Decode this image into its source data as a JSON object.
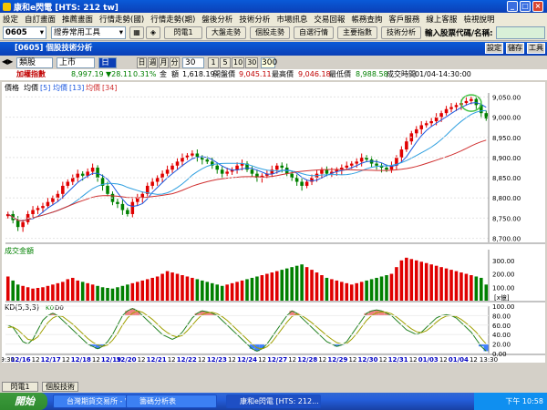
{
  "titlebar": {
    "title": "康和e閃電 [HTS: 212 tw]"
  },
  "menu": [
    "設定",
    "自訂畫面",
    "推薦畫面",
    "行情走勢(國)",
    "行情走勢(期)",
    "盤後分析",
    "技術分析",
    "市場訊息",
    "交易回報",
    "帳務查詢",
    "客戶服務",
    "線上客服",
    "檢視說明"
  ],
  "toolbar1": {
    "code": "0605",
    "group": "證券常用工具",
    "btn1": "閃電1",
    "btn2": "大盤走勢",
    "btn3": "個股走勢",
    "btn4": "自選行情",
    "btn5": "主要指數",
    "btn6": "技術分析",
    "prompt": "輸入股票代碼/名稱:"
  },
  "childbar": {
    "title": "[0605] 個股技術分析",
    "btn_settings": "設定",
    "btn_save": "儲存",
    "btn_tools": "工具"
  },
  "toolbar2": {
    "type": "類股",
    "market": "上市",
    "sel": "日",
    "periods": [
      "日",
      "週",
      "月",
      "分"
    ],
    "interval": "30",
    "nums": [
      "1",
      "5",
      "10",
      "30"
    ],
    "count": "300"
  },
  "infobar": {
    "name": "加權指數",
    "price": "8,997.19",
    "change": "▼28.11",
    "pct": "0.31%",
    "amount_label": "金",
    "amount2_label": "額",
    "amount": "1,618.19",
    "open_label": "開盤價",
    "open": "9,045.11",
    "high_label": "最高價",
    "high": "9,046.18",
    "low_label": "最低價",
    "low": "8,988.58",
    "time_label": "成交時間",
    "time": "01/04-14:30:00"
  },
  "legend": {
    "price": "價格",
    "ma_label": "均價",
    "ma5": "[5]",
    "ma13_label": "均價",
    "ma13": "[13]",
    "ma34_label": "均價",
    "ma34": "[34]"
  },
  "volume_label": "成交金額",
  "kd_label": "KD(5,3,3)",
  "kd_k": "K0",
  "kd_d": "D0",
  "y_ticks_price": [
    "9,050.00",
    "9,000.00",
    "8,950.00",
    "8,900.00",
    "8,850.00",
    "8,800.00",
    "8,750.00",
    "8,700.00"
  ],
  "y_ticks_vol": [
    "300.00",
    "200.00",
    "100.00"
  ],
  "vol_unit": "[x億]",
  "y_ticks_kd": [
    "100.00",
    "80.00",
    "60.00",
    "40.00",
    "20.00",
    "0.00"
  ],
  "x_labels": [
    "09:30",
    "12/16",
    "12",
    "12/17",
    "12",
    "12/18",
    "12",
    "12/19",
    "12/20",
    "12",
    "12/21",
    "12",
    "12/22",
    "12",
    "12/23",
    "12",
    "12/24",
    "12",
    "12/27",
    "12",
    "12/28",
    "12",
    "12/29",
    "12",
    "12/30",
    "12",
    "12/31",
    "12",
    "01/03",
    "12",
    "01/04",
    "12",
    "13:30"
  ],
  "bottom_tabs": [
    "閃電1",
    "個股技術"
  ],
  "taskbar": {
    "start": "開始",
    "tasks": [
      "台灣期貨交易所 - W...",
      "籌碼分析表",
      "康和e閃電 [HTS: 212..."
    ],
    "time": "下午 10:58"
  },
  "chart_data": {
    "type": "candlestick",
    "title": "加權指數",
    "ylim": [
      8690,
      9060
    ],
    "x_range": [
      "12/16 09:30",
      "01/04 13:30"
    ],
    "last": {
      "open": 9045.11,
      "high": 9046.18,
      "low": 8988.58,
      "close": 8997.19
    },
    "closes": [
      8760,
      8745,
      8728,
      8740,
      8760,
      8770,
      8775,
      8780,
      8790,
      8800,
      8810,
      8830,
      8840,
      8850,
      8860,
      8855,
      8865,
      8875,
      8850,
      8830,
      8810,
      8790,
      8785,
      8770,
      8760,
      8790,
      8800,
      8810,
      8830,
      8840,
      8850,
      8860,
      8870,
      8880,
      8890,
      8900,
      8905,
      8910,
      8900,
      8895,
      8890,
      8880,
      8870,
      8860,
      8865,
      8870,
      8880,
      8885,
      8870,
      8860,
      8850,
      8855,
      8860,
      8870,
      8880,
      8875,
      8860,
      8850,
      8840,
      8830,
      8840,
      8850,
      8860,
      8870,
      8860,
      8865,
      8870,
      8875,
      8880,
      8885,
      8890,
      8900,
      8895,
      8885,
      8880,
      8875,
      8870,
      8880,
      8900,
      8920,
      8940,
      8960,
      8970,
      8980,
      8985,
      8990,
      9000,
      9010,
      9020,
      9025,
      9030,
      9035,
      9040,
      9045,
      9030,
      9010,
      8997
    ],
    "volume": [
      180,
      150,
      120,
      110,
      100,
      90,
      95,
      100,
      110,
      120,
      130,
      140,
      160,
      170,
      150,
      140,
      130,
      120,
      110,
      100,
      95,
      90,
      100,
      110,
      120,
      130,
      140,
      150,
      160,
      170,
      180,
      200,
      220,
      210,
      200,
      190,
      180,
      170,
      160,
      150,
      140,
      130,
      120,
      110,
      120,
      130,
      140,
      150,
      160,
      170,
      180,
      190,
      200,
      210,
      220,
      230,
      240,
      250,
      260,
      270,
      250,
      230,
      210,
      190,
      170,
      160,
      150,
      140,
      130,
      120,
      130,
      140,
      150,
      160,
      170,
      180,
      190,
      200,
      250,
      300,
      320,
      310,
      300,
      290,
      280,
      270,
      260,
      250,
      240,
      230,
      220,
      210,
      200,
      190,
      180,
      170,
      120
    ],
    "kd_k": [
      60,
      55,
      40,
      25,
      20,
      30,
      50,
      70,
      80,
      85,
      80,
      70,
      60,
      50,
      40,
      30,
      20,
      15,
      10,
      15,
      25,
      40,
      60,
      80,
      90,
      95,
      90,
      80,
      70,
      60,
      50,
      40,
      35,
      30,
      35,
      45,
      60,
      75,
      85,
      90,
      88,
      85,
      80,
      70,
      60,
      50,
      40,
      30,
      20,
      10,
      5,
      10,
      20,
      35,
      50,
      65,
      80,
      90,
      85,
      75,
      65,
      55,
      45,
      35,
      25,
      20,
      15,
      18,
      25,
      40,
      55,
      70,
      85,
      90,
      92,
      90,
      85,
      80,
      70,
      60,
      50,
      45,
      40,
      45,
      55,
      65,
      75,
      80,
      82,
      80,
      75,
      65,
      55,
      45,
      30,
      15,
      5
    ],
    "kd_d": [
      55,
      56,
      50,
      40,
      30,
      28,
      35,
      50,
      65,
      75,
      80,
      78,
      70,
      62,
      52,
      42,
      32,
      24,
      18,
      15,
      18,
      28,
      42,
      60,
      75,
      85,
      90,
      87,
      80,
      72,
      62,
      52,
      44,
      38,
      35,
      38,
      48,
      60,
      72,
      82,
      86,
      87,
      84,
      78,
      70,
      60,
      50,
      40,
      30,
      20,
      12,
      10,
      14,
      24,
      38,
      52,
      66,
      78,
      83,
      80,
      73,
      65,
      56,
      47,
      38,
      30,
      23,
      20,
      21,
      30,
      42,
      56,
      70,
      80,
      86,
      88,
      87,
      84,
      77,
      69,
      60,
      52,
      46,
      44,
      48,
      56,
      66,
      74,
      79,
      80,
      78,
      72,
      64,
      55,
      45,
      32,
      20
    ]
  }
}
